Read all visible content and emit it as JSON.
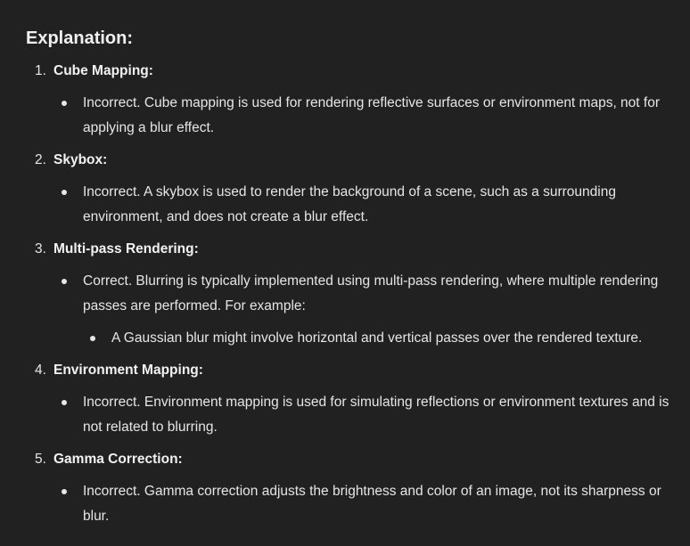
{
  "heading": "Explanation:",
  "items": [
    {
      "number": "1.",
      "title": "Cube Mapping:",
      "text": "Incorrect. Cube mapping is used for rendering reflective surfaces or environment maps, not for applying a blur effect."
    },
    {
      "number": "2.",
      "title": "Skybox:",
      "text": "Incorrect. A skybox is used to render the background of a scene, such as a surrounding environment, and does not create a blur effect."
    },
    {
      "number": "3.",
      "title": "Multi-pass Rendering:",
      "text": "Correct. Blurring is typically implemented using multi-pass rendering, where multiple rendering passes are performed. For example:",
      "sub": "A Gaussian blur might involve horizontal and vertical passes over the rendered texture."
    },
    {
      "number": "4.",
      "title": "Environment Mapping:",
      "text": "Incorrect. Environment mapping is used for simulating reflections or environment textures and is not related to blurring."
    },
    {
      "number": "5.",
      "title": "Gamma Correction:",
      "text": "Incorrect. Gamma correction adjusts the brightness and color of an image, not its sharpness or blur."
    }
  ]
}
